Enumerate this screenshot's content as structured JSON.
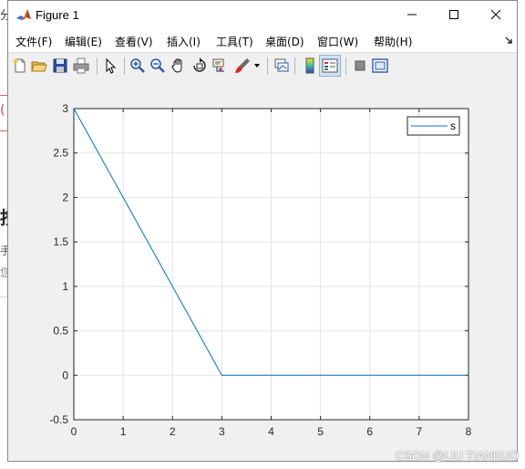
{
  "window": {
    "title": "Figure 1"
  },
  "background_fragments": {
    "top": "分",
    "red": "(",
    "heading": "按",
    "line1": "手",
    "line2": "您"
  },
  "menu": [
    {
      "label": "文件(F)"
    },
    {
      "label": "编辑(E)"
    },
    {
      "label": "查看(V)"
    },
    {
      "label": "插入(I)"
    },
    {
      "label": "工具(T)"
    },
    {
      "label": "桌面(D)"
    },
    {
      "label": "窗口(W)"
    },
    {
      "label": "帮助(H)"
    }
  ],
  "toolbar": {
    "icons": [
      "new-figure-icon",
      "open-file-icon",
      "save-icon",
      "print-icon",
      "pointer-icon",
      "zoom-in-icon",
      "zoom-out-icon",
      "pan-hand-icon",
      "rotate-3d-icon",
      "data-cursor-icon",
      "brush-icon",
      "link-plot-icon",
      "colorbar-icon",
      "legend-icon",
      "hide-plot-tools-icon",
      "show-plot-tools-icon"
    ]
  },
  "chart_data": {
    "type": "line",
    "title": "",
    "xlabel": "",
    "ylabel": "",
    "xlim": [
      0,
      8
    ],
    "ylim": [
      -0.5,
      3
    ],
    "xticks": [
      0,
      1,
      2,
      3,
      4,
      5,
      6,
      7,
      8
    ],
    "yticks": [
      -0.5,
      0,
      0.5,
      1,
      1.5,
      2,
      2.5,
      3
    ],
    "xtick_labels": [
      "0",
      "1",
      "2",
      "3",
      "4",
      "5",
      "6",
      "7",
      "8"
    ],
    "ytick_labels": [
      "-0.5",
      "0",
      "0.5",
      "1",
      "1.5",
      "2",
      "2.5",
      "3"
    ],
    "grid": true,
    "legend_position": "top-right",
    "series": [
      {
        "name": "s",
        "color": "#0072bd",
        "x": [
          0,
          3,
          8
        ],
        "y": [
          3,
          0,
          0
        ]
      }
    ]
  },
  "watermark": "CSDN @LIU TIANKUO"
}
